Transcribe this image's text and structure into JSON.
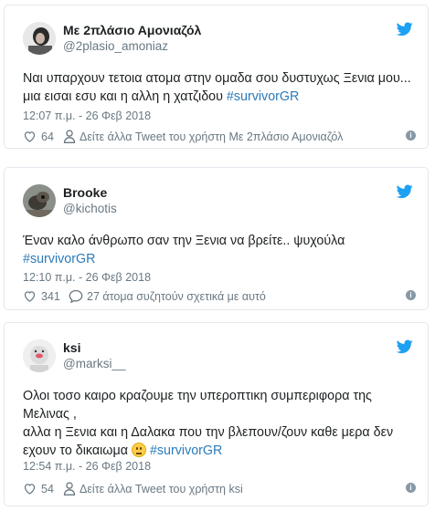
{
  "colors": {
    "link": "#2b7bb9",
    "meta": "#697882",
    "twitter_blue": "#1da1f2"
  },
  "tweets": [
    {
      "name": "Με 2πλάσιο Αμονιαζόλ",
      "handle": "@2plasio_amoniaz",
      "text_lines": [
        "Ναι υπαρχουν τετοια ατομα στην ομαδα σου δυστυχως Ξενια μου...",
        "μια εισαι εσυ και η αλλη η χατζιδου "
      ],
      "hashtag": "#survivorGR",
      "time": "12:07 π.μ. - 26 Φεβ 2018",
      "likes": "64",
      "more_text": "Δείτε άλλα Tweet του χρήστη Με 2πλάσιο Αμονιαζόλ",
      "avatar_icon": "user-avatar-photo",
      "twitter_icon": "twitter-bird-icon"
    },
    {
      "name": "Brooke",
      "handle": "@kichotis",
      "text_lines": [
        "Έναν καλο άνθρωπο σαν την Ξενια να βρείτε.. ψυχούλα"
      ],
      "hashtag": "#survivorGR",
      "time": "12:10 π.μ. - 26 Φεβ 2018",
      "likes": "341",
      "more_text": "27 άτομα συζητούν σχετικά με αυτό",
      "avatar_icon": "user-avatar-photo",
      "twitter_icon": "twitter-bird-icon"
    },
    {
      "name": "ksi",
      "handle": "@marksi__",
      "text_lines": [
        "Ολοι τοσο καιρο κραζουμε  την υπεροπτικη συμπεριφορα της Μελινας ,",
        "αλλα η Ξενια και η Δαλακα που την βλεπουν/ζουν καθε μερα δεν εχουν το δικαιωμα "
      ],
      "hashtag": "#survivorGR",
      "time": "12:54 π.μ. - 26 Φεβ 2018",
      "likes": "54",
      "more_text": "Δείτε άλλα Tweet του χρήστη ksi",
      "avatar_icon": "user-avatar-photo",
      "twitter_icon": "twitter-bird-icon"
    }
  ]
}
